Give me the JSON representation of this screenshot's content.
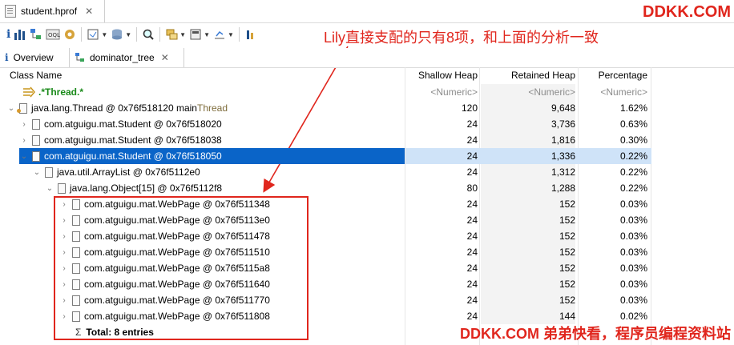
{
  "editor": {
    "tab_label": "student.hprof",
    "close": "✕"
  },
  "watermark_top": "DDKK.COM",
  "watermark_bottom": "DDKK.COM 弟弟快看，程序员编程资料站",
  "annotation": "Lily直接支配的只有8项，和上面的分析一致",
  "view_tabs": [
    {
      "label": "Overview",
      "close": ""
    },
    {
      "label": "dominator_tree",
      "close": "✕"
    }
  ],
  "columns": {
    "name": "Class Name",
    "shallow": "Shallow Heap",
    "retained": "Retained Heap",
    "percentage": "Percentage"
  },
  "filter": {
    "name": ".*Thread.*",
    "shallow": "<Numeric>",
    "retained": "<Numeric>",
    "percentage": "<Numeric>"
  },
  "rows": [
    {
      "name": "java.lang.Thread @ 0x76f518120  main ",
      "suffix": "Thread",
      "shallow": "120",
      "retained": "9,648",
      "percentage": "1.62%"
    },
    {
      "name": "com.atguigu.mat.Student @ 0x76f518020",
      "shallow": "24",
      "retained": "3,736",
      "percentage": "0.63%"
    },
    {
      "name": "com.atguigu.mat.Student @ 0x76f518038",
      "shallow": "24",
      "retained": "1,816",
      "percentage": "0.30%"
    },
    {
      "name": "com.atguigu.mat.Student @ 0x76f518050",
      "shallow": "24",
      "retained": "1,336",
      "percentage": "0.22%"
    },
    {
      "name": "java.util.ArrayList @ 0x76f5112e0",
      "shallow": "24",
      "retained": "1,312",
      "percentage": "0.22%"
    },
    {
      "name": "java.lang.Object[15] @ 0x76f5112f8",
      "shallow": "80",
      "retained": "1,288",
      "percentage": "0.22%"
    },
    {
      "name": "com.atguigu.mat.WebPage @ 0x76f511348",
      "shallow": "24",
      "retained": "152",
      "percentage": "0.03%"
    },
    {
      "name": "com.atguigu.mat.WebPage @ 0x76f5113e0",
      "shallow": "24",
      "retained": "152",
      "percentage": "0.03%"
    },
    {
      "name": "com.atguigu.mat.WebPage @ 0x76f511478",
      "shallow": "24",
      "retained": "152",
      "percentage": "0.03%"
    },
    {
      "name": "com.atguigu.mat.WebPage @ 0x76f511510",
      "shallow": "24",
      "retained": "152",
      "percentage": "0.03%"
    },
    {
      "name": "com.atguigu.mat.WebPage @ 0x76f5115a8",
      "shallow": "24",
      "retained": "152",
      "percentage": "0.03%"
    },
    {
      "name": "com.atguigu.mat.WebPage @ 0x76f511640",
      "shallow": "24",
      "retained": "152",
      "percentage": "0.03%"
    },
    {
      "name": "com.atguigu.mat.WebPage @ 0x76f511770",
      "shallow": "24",
      "retained": "152",
      "percentage": "0.03%"
    },
    {
      "name": "com.atguigu.mat.WebPage @ 0x76f511808",
      "shallow": "24",
      "retained": "144",
      "percentage": "0.02%"
    }
  ],
  "total": "Total: 8 entries",
  "icons": [
    "info-icon",
    "histogram-icon",
    "dominator-tree-icon",
    "oql-icon",
    "thread-overview-icon",
    "reports-icon",
    "query-browser-icon",
    "search-icon",
    "group-icon",
    "calculate-icon",
    "export-icon",
    "leak-icon"
  ]
}
